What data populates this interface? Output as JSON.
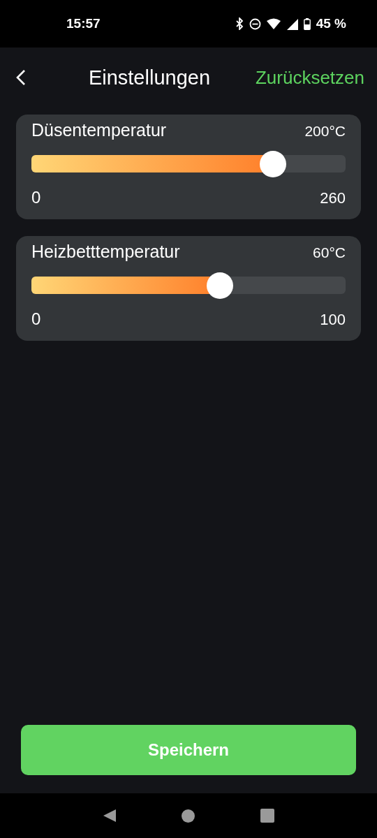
{
  "status_bar": {
    "time": "15:57",
    "battery": "45 %"
  },
  "header": {
    "title": "Einstellungen",
    "reset": "Zurücksetzen"
  },
  "sliders": [
    {
      "label": "Düsentemperatur",
      "reading": "200°C",
      "min": "0",
      "max": "260",
      "level": 0.769
    },
    {
      "label": "Heizbetttemperatur",
      "reading": "60°C",
      "min": "0",
      "max": "100",
      "level": 0.6
    }
  ],
  "save_button": "Speichern"
}
